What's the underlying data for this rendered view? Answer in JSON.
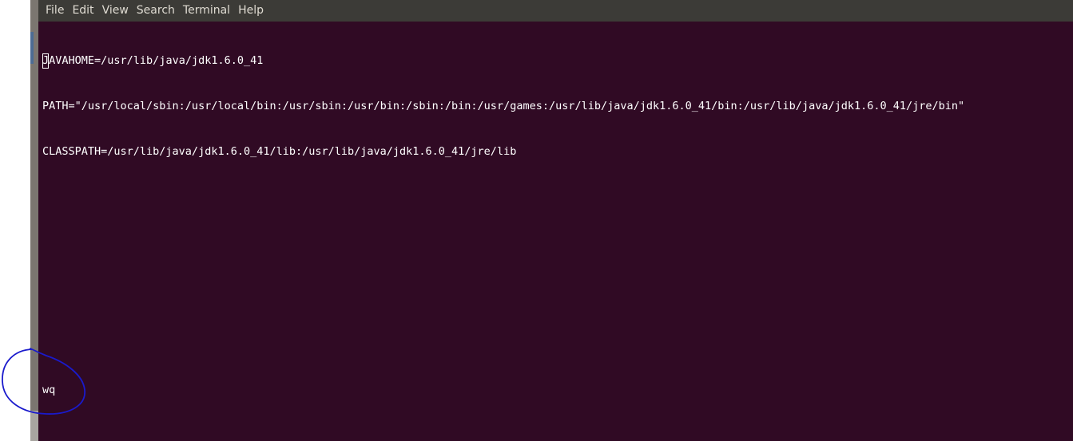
{
  "menubar": {
    "items": [
      {
        "label": "File"
      },
      {
        "label": "Edit"
      },
      {
        "label": "View"
      },
      {
        "label": "Search"
      },
      {
        "label": "Terminal"
      },
      {
        "label": "Help"
      }
    ]
  },
  "terminal": {
    "cursor_char": "J",
    "line1_rest": "AVAHOME=/usr/lib/java/jdk1.6.0_41",
    "line2": "PATH=\"/usr/local/sbin:/usr/local/bin:/usr/sbin:/usr/bin:/sbin:/bin:/usr/games:/usr/lib/java/jdk1.6.0_41/bin:/usr/lib/java/jdk1.6.0_41/jre/bin\"",
    "line3": "CLASSPATH=/usr/lib/java/jdk1.6.0_41/lib:/usr/lib/java/jdk1.6.0_41/jre/lib",
    "command": "wq"
  },
  "colors": {
    "terminal_bg": "#300a24",
    "menubar_bg": "#3c3b37",
    "annotation": "#1a1acc"
  }
}
